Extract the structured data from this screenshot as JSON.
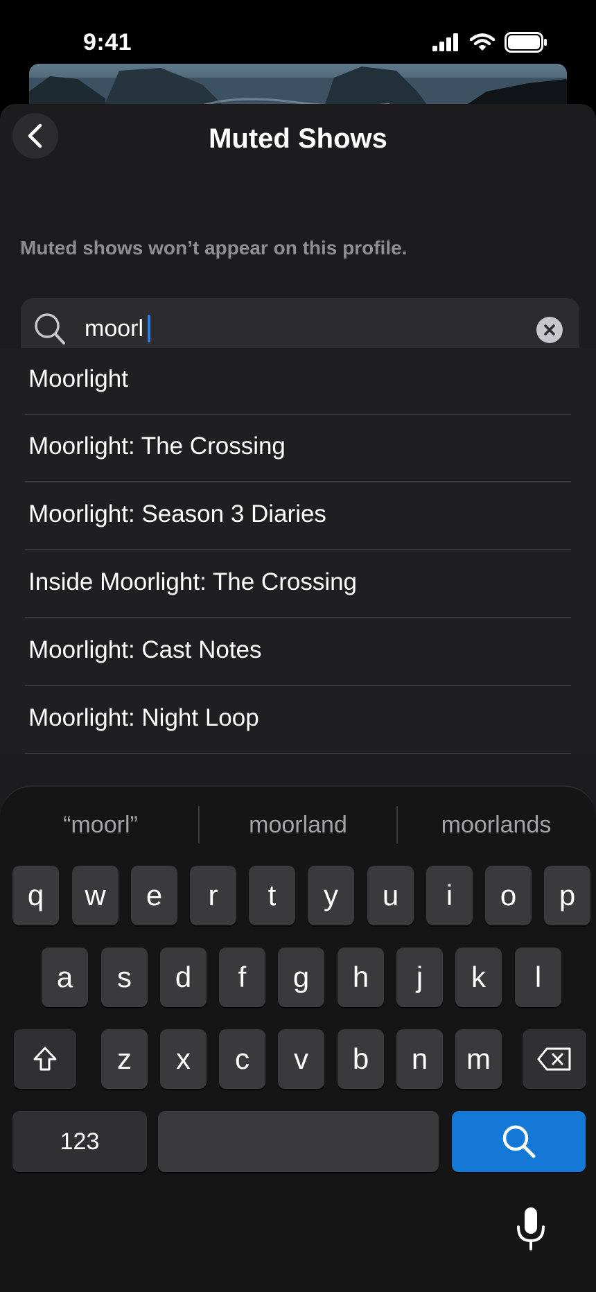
{
  "status_bar": {
    "time": "9:41"
  },
  "header": {
    "title": "Muted Shows"
  },
  "description": "Muted shows won’t appear on this profile.",
  "search": {
    "value": "moorl"
  },
  "results": [
    "Moorlight",
    "Moorlight: The Crossing",
    "Moorlight: Season 3 Diaries",
    "Inside Moorlight: The Crossing",
    "Moorlight: Cast Notes",
    "Moorlight: Night Loop"
  ],
  "keyboard": {
    "suggestions": [
      "“moorl”",
      "moorland",
      "moorlands"
    ],
    "row1": [
      "q",
      "w",
      "e",
      "r",
      "t",
      "y",
      "u",
      "i",
      "o",
      "p"
    ],
    "row2": [
      "a",
      "s",
      "d",
      "f",
      "g",
      "h",
      "j",
      "k",
      "l"
    ],
    "row3": [
      "z",
      "x",
      "c",
      "v",
      "b",
      "n",
      "m"
    ],
    "numbers_label": "123",
    "accent_color": "#1479d6"
  },
  "icons": [
    "back-chevron-icon",
    "search-icon",
    "clear-icon",
    "shift-icon",
    "delete-icon",
    "mic-icon",
    "signal-icon",
    "wifi-icon",
    "battery-icon"
  ]
}
